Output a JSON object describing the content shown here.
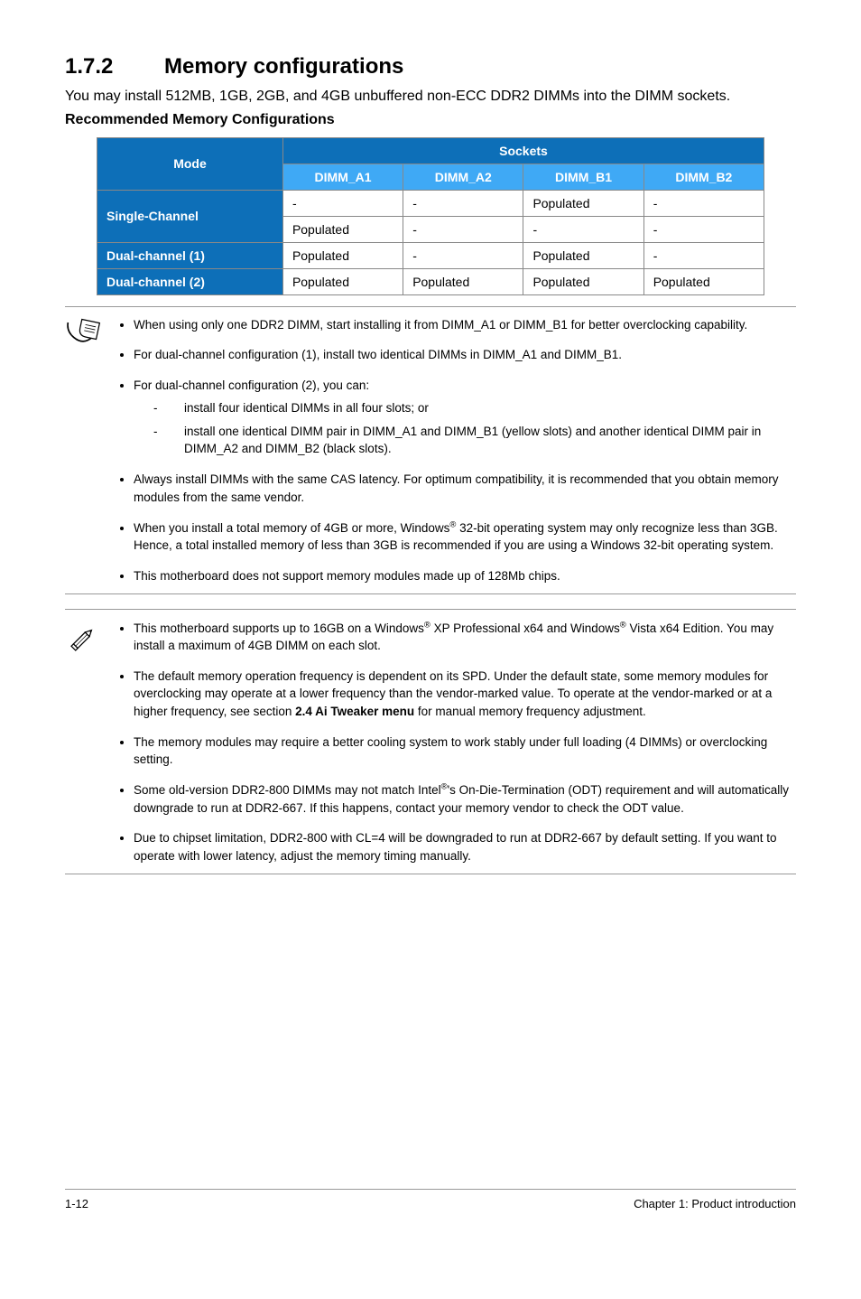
{
  "heading": {
    "number": "1.7.2",
    "title": "Memory configurations"
  },
  "lead": "You may install 512MB, 1GB, 2GB, and 4GB unbuffered non-ECC DDR2 DIMMs into the DIMM sockets.",
  "subhead": "Recommended Memory Configurations",
  "table": {
    "mode_header": "Mode",
    "sockets_header": "Sockets",
    "col_headers": [
      "DIMM_A1",
      "DIMM_A2",
      "DIMM_B1",
      "DIMM_B2"
    ],
    "rows": [
      {
        "label": "Single-Channel",
        "rowspan": 2,
        "cells": [
          "-",
          "-",
          "Populated",
          "-"
        ]
      },
      {
        "label": "",
        "rowspan": 0,
        "cells": [
          "Populated",
          "-",
          "-",
          "-"
        ]
      },
      {
        "label": "Dual-channel (1)",
        "rowspan": 1,
        "cells": [
          "Populated",
          "-",
          "Populated",
          "-"
        ]
      },
      {
        "label": "Dual-channel (2)",
        "rowspan": 1,
        "cells": [
          "Populated",
          "Populated",
          "Populated",
          "Populated"
        ]
      }
    ]
  },
  "note1": {
    "items": [
      {
        "text": "When using only one DDR2 DIMM, start installing it from DIMM_A1 or DIMM_B1 for better overclocking capability."
      },
      {
        "text": "For dual-channel configuration (1), install two identical DIMMs in DIMM_A1 and DIMM_B1."
      },
      {
        "text": "For dual-channel configuration (2), you can:",
        "sub": [
          "install four identical DIMMs in all four slots; or",
          "install one identical DIMM pair in DIMM_A1 and DIMM_B1 (yellow slots) and another identical DIMM pair in DIMM_A2 and DIMM_B2 (black slots)."
        ]
      },
      {
        "text": "Always install DIMMs with the same CAS latency. For optimum compatibility, it is recommended that you obtain memory modules from the same vendor."
      },
      {
        "html": "When you install a total memory of 4GB or more, Windows<sup>®</sup> 32-bit operating system may only recognize less than 3GB. Hence, a total installed memory of less than 3GB is recommended if you are using a Windows 32-bit operating system."
      },
      {
        "text": "This motherboard does not support memory modules made up of 128Mb chips."
      }
    ]
  },
  "note2": {
    "items": [
      {
        "html": "This motherboard supports up to 16GB on a Windows<sup>®</sup> XP Professional x64 and Windows<sup>®</sup> Vista x64 Edition. You may install a maximum of 4GB DIMM on each slot."
      },
      {
        "html": "The default memory operation frequency is dependent on its SPD. Under the default state, some memory modules for overclocking may operate at a lower frequency than the vendor-marked value. To operate at the vendor-marked or at a higher frequency, see section <b>2.4 Ai Tweaker menu</b> for manual memory frequency adjustment."
      },
      {
        "text": "The memory modules may require a better cooling system to work stably under full loading (4 DIMMs) or overclocking setting."
      },
      {
        "html": "Some old-version DDR2-800 DIMMs may not match Intel<sup>®</sup>'s On-Die-Termination (ODT) requirement and will automatically downgrade to run at DDR2-667. If this happens, contact your memory vendor to check the ODT value."
      },
      {
        "text": "Due to chipset limitation, DDR2-800 with CL=4 will be downgraded to run at DDR2-667 by default setting. If you want to operate with lower latency, adjust the memory timing manually."
      }
    ]
  },
  "footer": {
    "left": "1-12",
    "right": "Chapter 1: Product introduction"
  }
}
